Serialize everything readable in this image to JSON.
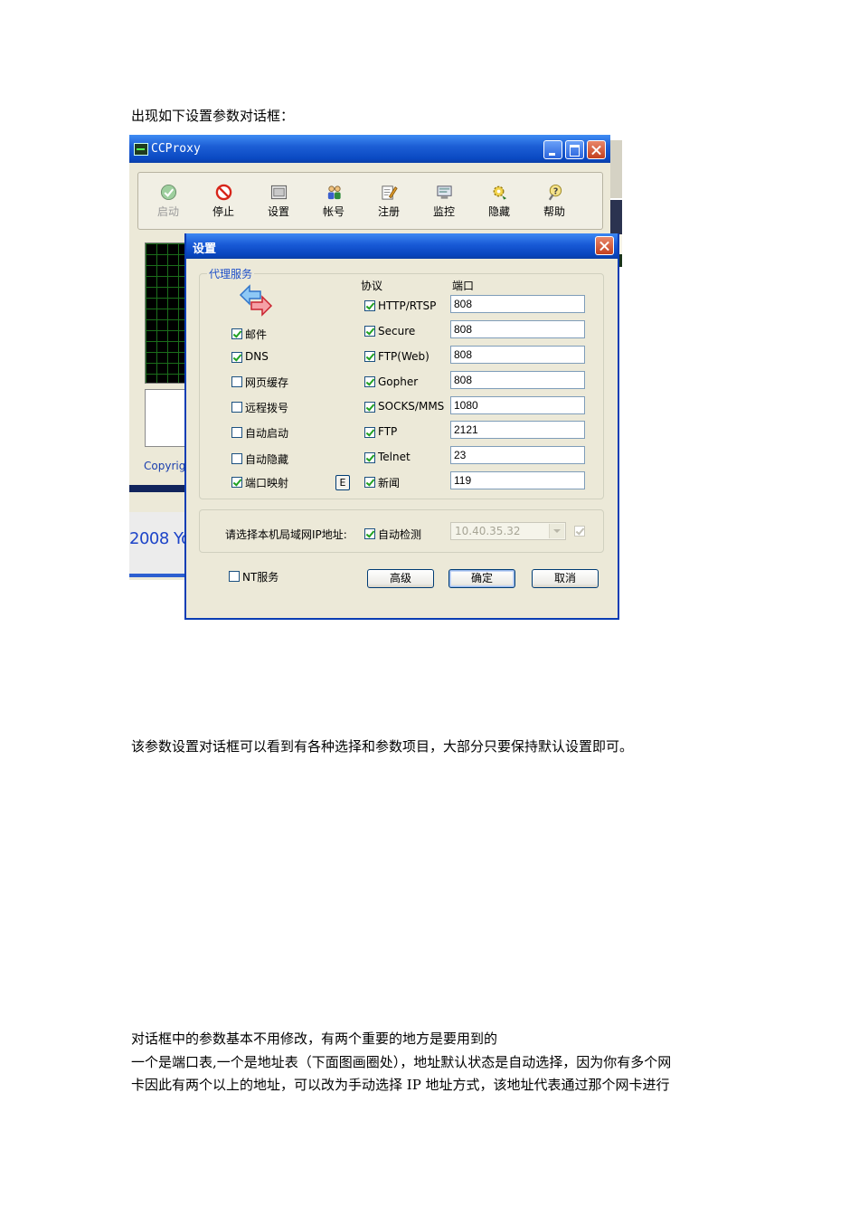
{
  "doc": {
    "intro_line": "出现如下设置参数对话框：",
    "caption_line": "该参数设置对话框可以看到有各种选择和参数项目，大部分只要保持默认设置即可。",
    "para_line1": "对话框中的参数基本不用修改，有两个重要的地方是要用到的",
    "para_line2": "一个是端口表,一个是地址表（下面图画圈处），地址默认状态是自动选择，因为你有多个网",
    "para_line3": "卡因此有两个以上的地址，可以改为手动选择 IP 地址方式，该地址代表通过那个网卡进行"
  },
  "main_window": {
    "title": "CCProxy",
    "toolbar": [
      {
        "label": "启动",
        "icon": "start-check-icon",
        "disabled": true
      },
      {
        "label": "停止",
        "icon": "stop-icon"
      },
      {
        "label": "设置",
        "icon": "settings-window-icon"
      },
      {
        "label": "帐号",
        "icon": "account-users-icon"
      },
      {
        "label": "注册",
        "icon": "register-pencil-icon"
      },
      {
        "label": "监控",
        "icon": "monitor-icon"
      },
      {
        "label": "隐藏",
        "icon": "hide-gear-icon"
      },
      {
        "label": "帮助",
        "icon": "help-icon"
      }
    ],
    "copyright_fragment": "Copyrigh",
    "year_fragment": "2008 Yo"
  },
  "settings_dialog": {
    "title": "设置",
    "group_title": "代理服务",
    "col_protocol": "协议",
    "col_port": "端口",
    "left_options": [
      {
        "label": "邮件",
        "checked": true
      },
      {
        "label": "DNS",
        "checked": true
      },
      {
        "label": "网页缓存",
        "checked": false
      },
      {
        "label": "远程拨号",
        "checked": false
      },
      {
        "label": "自动启动",
        "checked": false
      },
      {
        "label": "自动隐藏",
        "checked": false
      },
      {
        "label": "端口映射",
        "checked": true
      }
    ],
    "e_button": "E",
    "protocols": [
      {
        "label": "HTTP/RTSP",
        "checked": true,
        "port": "808"
      },
      {
        "label": "Secure",
        "checked": true,
        "port": "808"
      },
      {
        "label": "FTP(Web)",
        "checked": true,
        "port": "808"
      },
      {
        "label": "Gopher",
        "checked": true,
        "port": "808"
      },
      {
        "label": "SOCKS/MMS",
        "checked": true,
        "port": "1080"
      },
      {
        "label": "FTP",
        "checked": true,
        "port": "2121"
      },
      {
        "label": "Telnet",
        "checked": true,
        "port": "23"
      },
      {
        "label": "新闻",
        "checked": true,
        "port": "119"
      }
    ],
    "ip_label": "请选择本机局域网IP地址:",
    "auto_detect_label": "自动检测",
    "auto_detect_checked": true,
    "ip_value": "10.40.35.32",
    "nt_service_label": "NT服务",
    "nt_service_checked": false,
    "btn_advanced": "高级",
    "btn_ok": "确定",
    "btn_cancel": "取消"
  }
}
